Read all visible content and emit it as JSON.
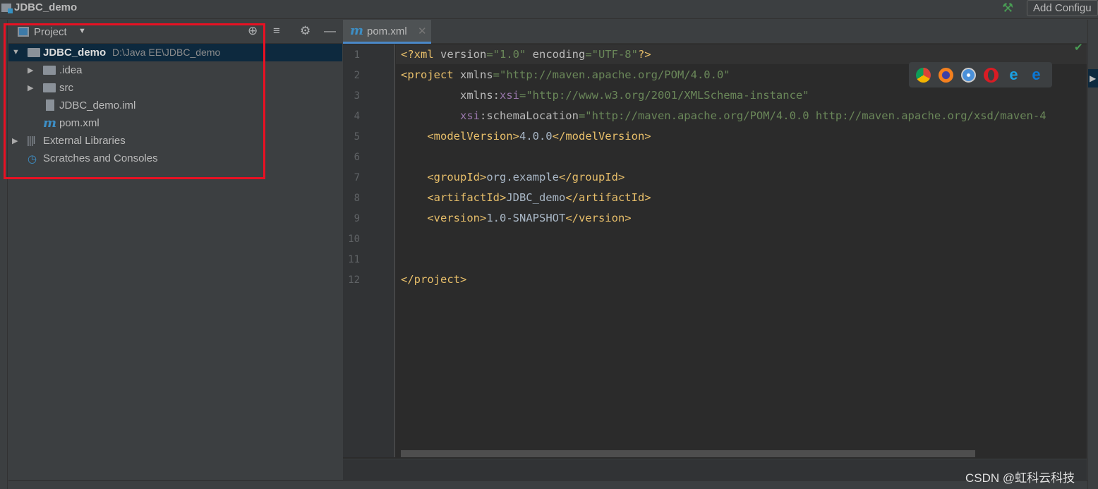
{
  "window": {
    "title": "JDBC_demo",
    "add_config_label": "Add Configu",
    "build_icon": "hammer-icon"
  },
  "project_panel": {
    "title": "Project",
    "toolbar_icons": [
      "locate-icon",
      "collapse-all-icon",
      "gear-icon",
      "minimize-icon"
    ],
    "tree": [
      {
        "label": "JDBC_demo",
        "path": "D:\\Java EE\\JDBC_demo",
        "icon": "module-folder-icon",
        "expanded": true,
        "selected": true
      },
      {
        "label": ".idea",
        "icon": "folder-icon",
        "expandable": true
      },
      {
        "label": "src",
        "icon": "folder-icon",
        "expandable": true
      },
      {
        "label": "JDBC_demo.iml",
        "icon": "iml-file-icon"
      },
      {
        "label": "pom.xml",
        "icon": "maven-icon"
      },
      {
        "label": "External Libraries",
        "icon": "libraries-icon",
        "expandable": true
      },
      {
        "label": "Scratches and Consoles",
        "icon": "scratches-icon"
      }
    ],
    "highlight_color": "#e81123"
  },
  "editor": {
    "tab": {
      "label": "pom.xml",
      "icon": "maven-icon"
    },
    "line_numbers": [
      "1",
      "2",
      "3",
      "4",
      "5",
      "6",
      "7",
      "8",
      "9",
      "10",
      "11",
      "12"
    ],
    "lines": [
      [
        [
          "tg",
          "<?xml "
        ],
        [
          "at",
          "version"
        ],
        [
          "va",
          "=\"1.0\" "
        ],
        [
          "at",
          "encoding"
        ],
        [
          "va",
          "=\"UTF-8\""
        ],
        [
          "tg",
          "?>"
        ]
      ],
      [
        [
          "tg",
          "<project "
        ],
        [
          "at",
          "xmlns"
        ],
        [
          "va",
          "=\"http://maven.apache.org/POM/4.0.0\""
        ]
      ],
      [
        [
          "at",
          "         xmlns:"
        ],
        [
          "ns",
          "xsi"
        ],
        [
          "va",
          "=\"http://www.w3.org/2001/XMLSchema-instance\""
        ]
      ],
      [
        [
          "ns",
          "         xsi"
        ],
        [
          "at",
          ":schemaLocation"
        ],
        [
          "va",
          "=\"http://maven.apache.org/POM/4.0.0 http://maven.apache.org/xsd/maven-4"
        ]
      ],
      [
        [
          "tg",
          "    <modelVersion>"
        ],
        [
          "tx",
          "4.0.0"
        ],
        [
          "tg",
          "</modelVersion>"
        ]
      ],
      [],
      [
        [
          "tg",
          "    <groupId>"
        ],
        [
          "tx",
          "org.example"
        ],
        [
          "tg",
          "</groupId>"
        ]
      ],
      [
        [
          "tg",
          "    <artifactId>"
        ],
        [
          "tx",
          "JDBC_demo"
        ],
        [
          "tg",
          "</artifactId>"
        ]
      ],
      [
        [
          "tg",
          "    <version>"
        ],
        [
          "tx",
          "1.0-SNAPSHOT"
        ],
        [
          "tg",
          "</version>"
        ]
      ],
      [],
      [],
      [
        [
          "tg",
          "</project>"
        ]
      ]
    ],
    "browser_icons": [
      "chrome-icon",
      "firefox-icon",
      "safari-icon",
      "opera-icon",
      "ie-icon",
      "edge-icon"
    ],
    "status_icon": "check-icon"
  },
  "watermark": "CSDN @虹科云科技",
  "colors": {
    "tag": "#e8bf6a",
    "attr": "#bababa",
    "value": "#6a8759",
    "namespace": "#9876aa",
    "selection": "#0d293e"
  }
}
